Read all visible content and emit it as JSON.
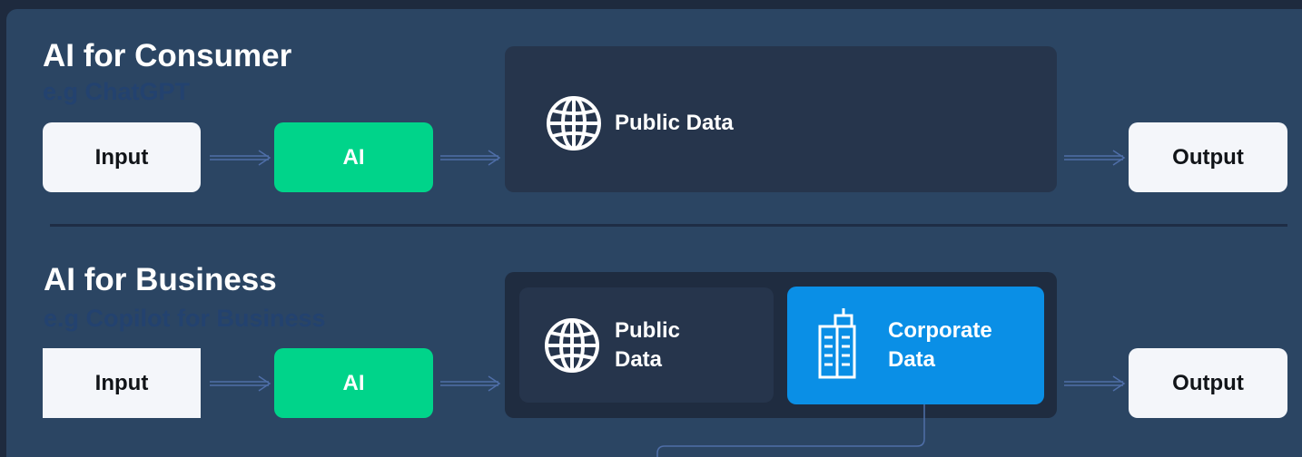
{
  "consumer": {
    "title": "AI for Consumer",
    "subtitle": "e.g ChatGPT",
    "input_label": "Input",
    "ai_label": "AI",
    "public_data_label": "Public Data",
    "output_label": "Output"
  },
  "business": {
    "title": "AI for Business",
    "subtitle": "e.g Copilot for Business",
    "input_label": "Input",
    "ai_label": "AI",
    "public_data_label": "Public Data",
    "corporate_data_label": "Corporate Data",
    "output_label": "Output"
  },
  "colors": {
    "background": "#1e2a3e",
    "panel": "#2b4563",
    "ai_green": "#00d48a",
    "corporate_blue": "#0a8fe6",
    "data_box": "#26354c",
    "connector": "#4f6ea8"
  },
  "icons": {
    "public_data": "globe-icon",
    "corporate_data": "building-icon"
  }
}
